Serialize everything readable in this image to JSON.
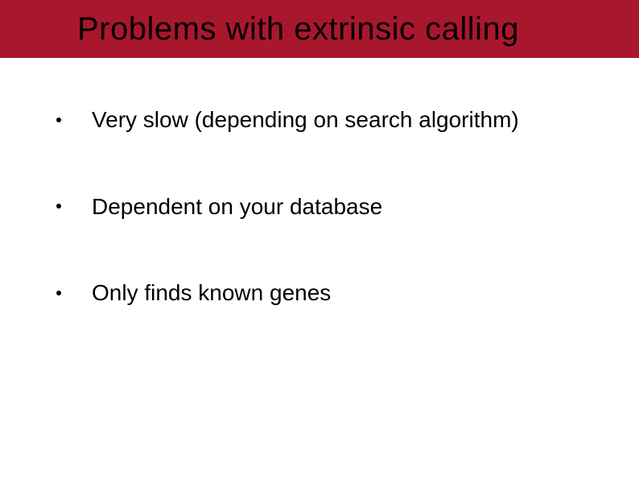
{
  "colors": {
    "titleBarBg": "#a9172d",
    "titleTextColor": "#000000",
    "bodyText": "#000000"
  },
  "slide": {
    "title": "Problems with extrinsic calling",
    "bullets": [
      "Very slow (depending on search algorithm)",
      "Dependent on your database",
      "Only finds known genes"
    ]
  }
}
